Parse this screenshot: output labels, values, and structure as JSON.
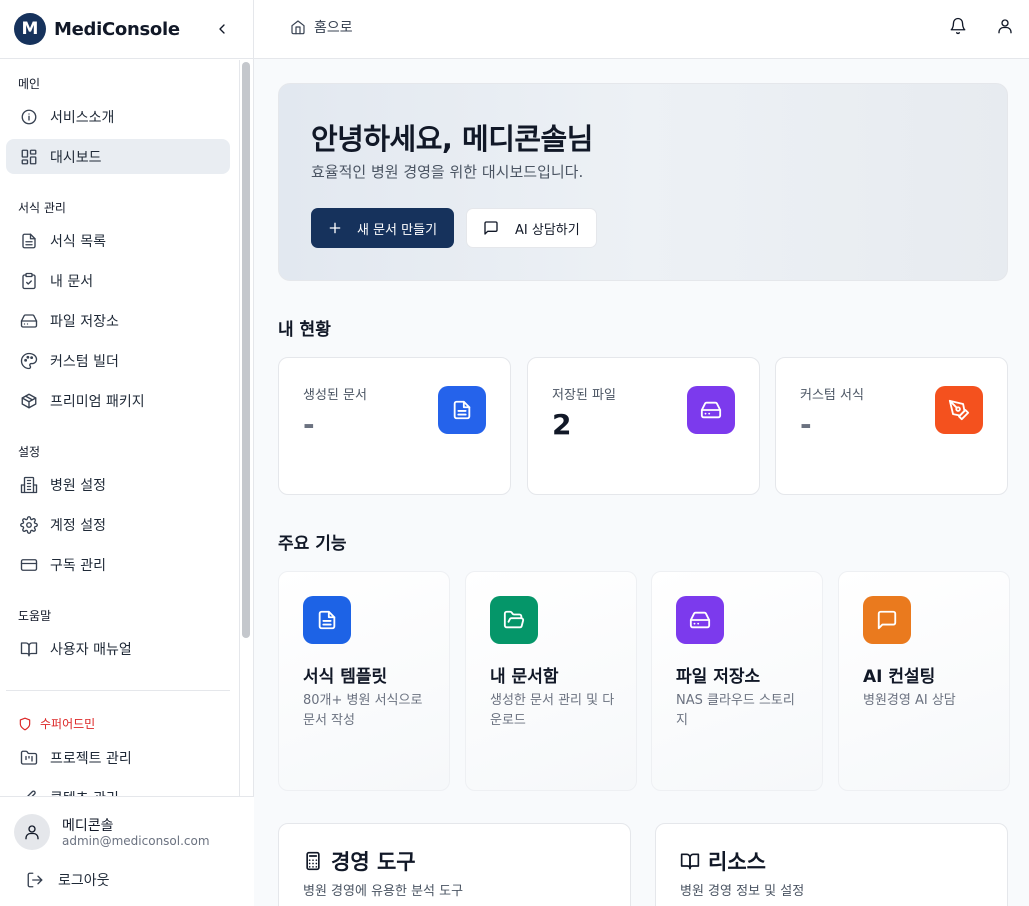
{
  "app": {
    "logo_letter": "M",
    "name": "MediConsole"
  },
  "sidebar": {
    "sections": {
      "main": "메인",
      "forms": "서식 관리",
      "settings": "설정",
      "help": "도움말",
      "admin": "수퍼어드민"
    },
    "items": {
      "service_intro": "서비스소개",
      "dashboard": "대시보드",
      "form_list": "서식 목록",
      "my_docs": "내 문서",
      "file_storage": "파일 저장소",
      "custom_builder": "커스텀 빌더",
      "premium_package": "프리미엄 패키지",
      "hospital_settings": "병원 설정",
      "account_settings": "계정 설정",
      "subscription": "구독 관리",
      "user_manual": "사용자 매뉴얼",
      "project_mgmt": "프로젝트 관리",
      "content_mgmt": "콘텐츠 관리"
    },
    "active": "dashboard"
  },
  "user": {
    "name": "메디콘솔",
    "email": "admin@mediconsol.com",
    "logout": "로그아웃"
  },
  "topbar": {
    "home": "홈으로"
  },
  "hero": {
    "title": "안녕하세요, 메디콘솔님",
    "subtitle": "효율적인 병원 경영을 위한 대시보드입니다.",
    "new_doc_button": "새 문서 만들기",
    "ai_button": "AI 상담하기"
  },
  "status": {
    "title": "내 현황",
    "cards": [
      {
        "label": "생성된 문서",
        "value": "-",
        "color": "#2563eb"
      },
      {
        "label": "저장된 파일",
        "value": "2",
        "color": "#7c3aed"
      },
      {
        "label": "커스텀 서식",
        "value": "-",
        "color": "#f4511e"
      }
    ]
  },
  "features": {
    "title": "주요 기능",
    "cards": [
      {
        "title": "서식 템플릿",
        "desc": "80개+ 병원 서식으로 문서 작성",
        "color": "#1d63e6"
      },
      {
        "title": "내 문서함",
        "desc": "생성한 문서 관리 및 다운로드",
        "color": "#059669"
      },
      {
        "title": "파일 저장소",
        "desc": "NAS 클라우드 스토리지",
        "color": "#7c3aed"
      },
      {
        "title": "AI 컨설팅",
        "desc": "병원경영 AI 상담",
        "color": "#ea7a1e"
      }
    ]
  },
  "tools": {
    "management": {
      "title": "경영 도구",
      "subtitle": "병원 경영에 유용한 분석 도구"
    },
    "resources": {
      "title": "리소스",
      "subtitle": "병원 경영 정보 및 설정"
    }
  }
}
